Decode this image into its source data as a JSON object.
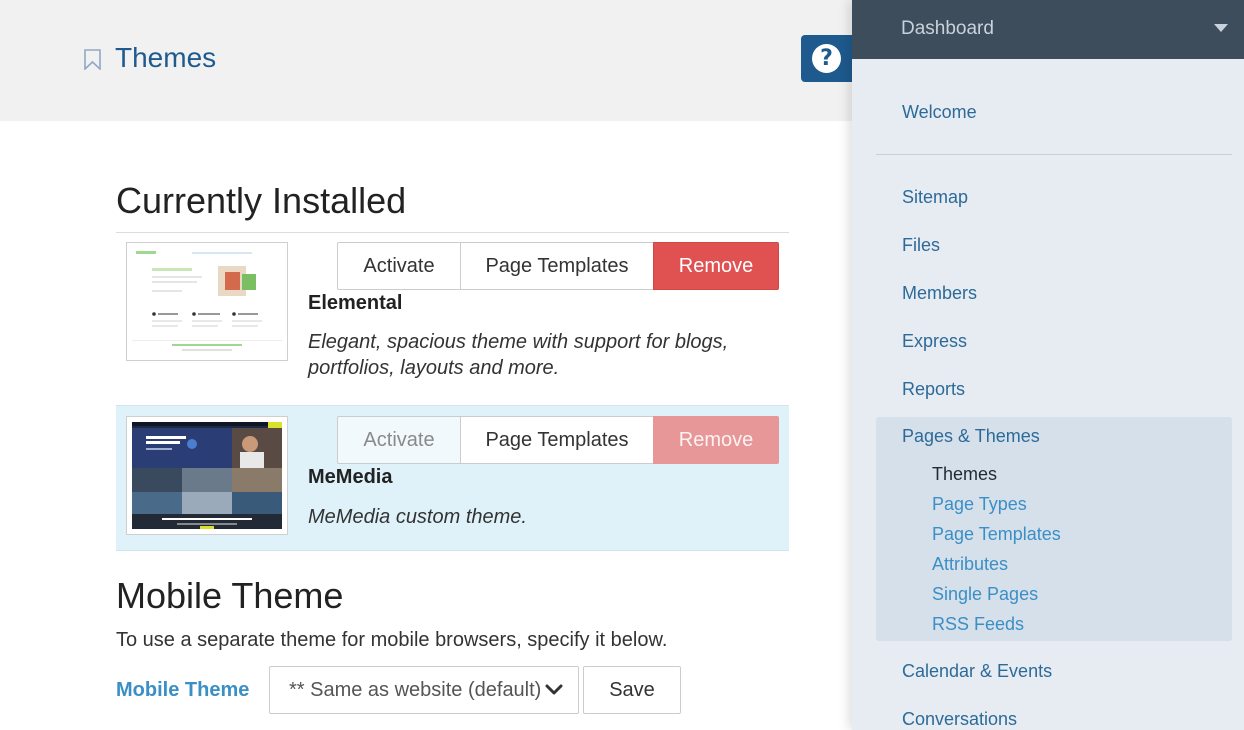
{
  "header": {
    "title": "Themes",
    "help_symbol": "?"
  },
  "main": {
    "installed_title": "Currently Installed",
    "themes": [
      {
        "name": "Elemental",
        "description": "Elegant, spacious theme with support for blogs, portfolios, layouts and more.",
        "activate_label": "Activate",
        "templates_label": "Page Templates",
        "remove_label": "Remove",
        "active": false
      },
      {
        "name": "MeMedia",
        "description": "MeMedia custom theme.",
        "activate_label": "Activate",
        "templates_label": "Page Templates",
        "remove_label": "Remove",
        "active": true
      }
    ],
    "mobile": {
      "title": "Mobile Theme",
      "description": "To use a separate theme for mobile browsers, specify it below.",
      "label": "Mobile Theme",
      "selected": "** Same as website (default)",
      "save_label": "Save"
    }
  },
  "sidebar": {
    "dashboard_label": "Dashboard",
    "items": [
      {
        "label": "Welcome"
      },
      {
        "label": "Sitemap"
      },
      {
        "label": "Files"
      },
      {
        "label": "Members"
      },
      {
        "label": "Express"
      },
      {
        "label": "Reports"
      },
      {
        "label": "Pages & Themes"
      },
      {
        "label": "Calendar & Events"
      },
      {
        "label": "Conversations"
      }
    ],
    "sub_items": [
      {
        "label": "Themes",
        "active": true
      },
      {
        "label": "Page Types"
      },
      {
        "label": "Page Templates"
      },
      {
        "label": "Attributes"
      },
      {
        "label": "Single Pages"
      },
      {
        "label": "RSS Feeds"
      }
    ]
  },
  "colors": {
    "brand_blue": "#1e5a8e",
    "link_blue": "#3a8fc7",
    "remove_red": "#e05252",
    "selected_row": "#dff2f9",
    "sidebar_top": "#3d4d5c"
  }
}
